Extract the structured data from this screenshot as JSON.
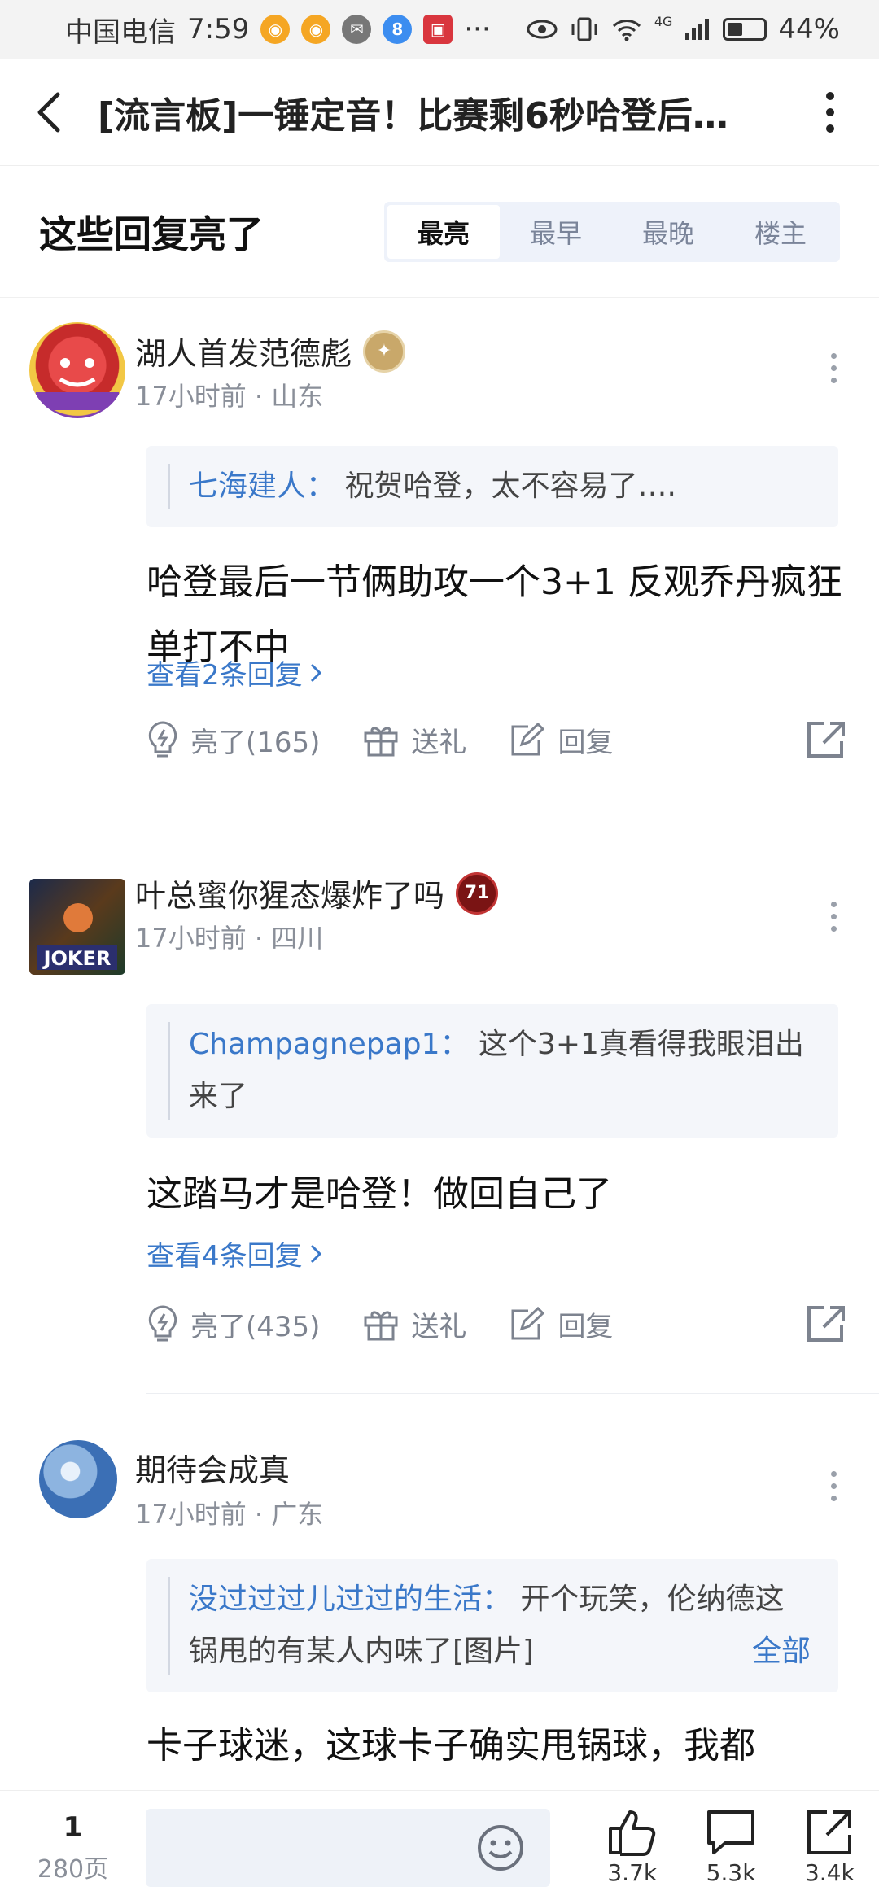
{
  "status_bar": {
    "carrier": "中国电信",
    "time": "7:59",
    "battery": "44%",
    "battery_level": 0.44,
    "dots": "···",
    "network": "4G"
  },
  "header": {
    "title": "[流言板]一锤定音！比赛剩6秒哈登后…"
  },
  "section": {
    "title": "这些回复亮了",
    "tabs": [
      "最亮",
      "最早",
      "最晚",
      "楼主"
    ]
  },
  "comments": [
    {
      "username": "湖人首发范德彪",
      "time": "17小时前",
      "location": "山东",
      "quote_user": "七海建人",
      "quote_text": "祝贺哈登，太不容易了….",
      "text": "哈登最后一节俩助攻一个3+1 反观乔丹疯狂单打不中",
      "replies": "查看2条回复",
      "likes": "亮了(165)",
      "gift": "送礼",
      "reply": "回复"
    },
    {
      "username": "叶总蜜你猩态爆炸了吗",
      "time": "17小时前",
      "location": "四川",
      "quote_user": "Champagnepap1",
      "quote_text": "这个3+1真看得我眼泪出来了",
      "text": "这踏马才是哈登！做回自己了",
      "replies": "查看4条回复",
      "likes": "亮了(435)",
      "gift": "送礼",
      "reply": "回复",
      "badge_text": "71"
    },
    {
      "username": "期待会成真",
      "time": "17小时前",
      "location": "广东",
      "quote_user": "没过过过儿过过的生活",
      "quote_text": "开个玩笑，伦纳德这锅甩的有某人内味了[图片]",
      "quote_more": "全部",
      "text": "卡子球迷，这球卡子确实甩锅球，我都"
    }
  ],
  "bottom": {
    "page_current": "1",
    "page_total": "280页",
    "like_count": "3.7k",
    "comment_count": "5.3k",
    "share_count": "3.4k"
  },
  "colors": {
    "link_blue": "#3a78c9",
    "muted_gray": "#8a8f99",
    "tab_bg": "#eef2fa"
  }
}
